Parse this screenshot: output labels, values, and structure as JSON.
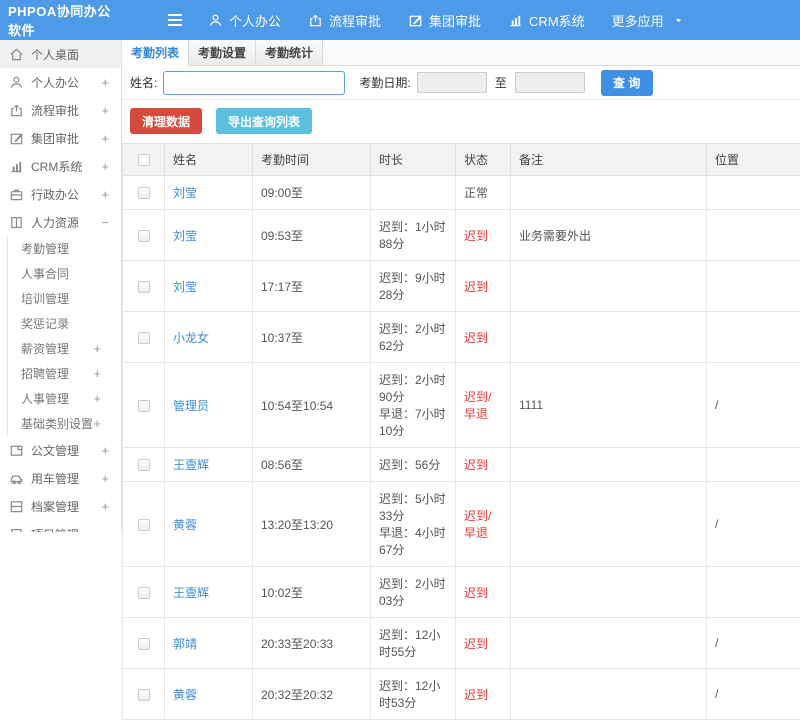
{
  "colors": {
    "header_blue": "#4d9ae8",
    "link_blue": "#3c8dde",
    "active_tab_blue": "#2f87d8",
    "query_button_blue": "#3f8fe5",
    "danger_red": "#d6493d",
    "info_blue": "#5bc0de",
    "late_text_red": "#e43a3a"
  },
  "header": {
    "logo": "PHPOA协同办公软件",
    "menu_icon": "menu-icon",
    "nav": [
      {
        "label": "个人办公",
        "icon": "user-icon",
        "caret": false
      },
      {
        "label": "流程审批",
        "icon": "share-icon",
        "caret": false
      },
      {
        "label": "集团审批",
        "icon": "edit-icon",
        "caret": false
      },
      {
        "label": "CRM系统",
        "icon": "chart-icon",
        "caret": false
      },
      {
        "label": "更多应用",
        "icon": "",
        "caret": true,
        "caret_icon": "caret-down-icon"
      }
    ]
  },
  "sidebar": {
    "items": [
      {
        "label": "个人桌面",
        "icon": "home-icon",
        "level": 0,
        "active": true,
        "expand": ""
      },
      {
        "label": "个人办公",
        "icon": "user-icon",
        "level": 0,
        "active": false,
        "expand": "+"
      },
      {
        "label": "流程审批",
        "icon": "share-icon",
        "level": 0,
        "active": false,
        "expand": "+"
      },
      {
        "label": "集团审批",
        "icon": "edit-icon",
        "level": 0,
        "active": false,
        "expand": "+"
      },
      {
        "label": "CRM系统",
        "icon": "chart-icon",
        "level": 0,
        "active": false,
        "expand": "+"
      },
      {
        "label": "行政办公",
        "icon": "briefcase-icon",
        "level": 0,
        "active": false,
        "expand": "+"
      },
      {
        "label": "人力资源",
        "icon": "book-icon",
        "level": 0,
        "active": false,
        "expand": "−"
      },
      {
        "label": "考勤管理",
        "icon": "",
        "level": 1,
        "active": false,
        "expand": ""
      },
      {
        "label": "人事合同",
        "icon": "",
        "level": 1,
        "active": false,
        "expand": ""
      },
      {
        "label": "培训管理",
        "icon": "",
        "level": 1,
        "active": false,
        "expand": ""
      },
      {
        "label": "奖惩记录",
        "icon": "",
        "level": 1,
        "active": false,
        "expand": ""
      },
      {
        "label": "薪资管理",
        "icon": "",
        "level": 1,
        "active": false,
        "expand": "+"
      },
      {
        "label": "招聘管理",
        "icon": "",
        "level": 1,
        "active": false,
        "expand": "+"
      },
      {
        "label": "人事管理",
        "icon": "",
        "level": 1,
        "active": false,
        "expand": "+"
      },
      {
        "label": "基础类别设置",
        "icon": "",
        "level": 1,
        "active": false,
        "expand": "+"
      },
      {
        "label": "公文管理",
        "icon": "document-icon",
        "level": 0,
        "active": false,
        "expand": "+"
      },
      {
        "label": "用车管理",
        "icon": "car-icon",
        "level": 0,
        "active": false,
        "expand": "+"
      },
      {
        "label": "档案管理",
        "icon": "archive-icon",
        "level": 0,
        "active": false,
        "expand": "+"
      },
      {
        "label": "项目管理",
        "icon": "project-icon",
        "level": 0,
        "active": false,
        "expand": "+"
      }
    ]
  },
  "tabs": [
    {
      "label": "考勤列表",
      "active": true
    },
    {
      "label": "考勤设置",
      "active": false
    },
    {
      "label": "考勤统计",
      "active": false
    }
  ],
  "search": {
    "name_label": "姓名:",
    "name_value": "",
    "date_label": "考勤日期:",
    "date_from": "",
    "to_label": "至",
    "date_to": "",
    "query_button": "查 询"
  },
  "actions": {
    "clean_data": "清理数据",
    "export_list": "导出查询列表"
  },
  "table": {
    "columns": [
      "姓名",
      "考勤时间",
      "时长",
      "状态",
      "备注",
      "位置"
    ],
    "rows": [
      {
        "name": "刘莹",
        "time": "09:00至",
        "duration": "",
        "status": "正常",
        "is_late": false,
        "remark": "",
        "location": ""
      },
      {
        "name": "刘莹",
        "time": "09:53至",
        "duration": "迟到：1小时88分",
        "status": "迟到",
        "is_late": true,
        "remark": "业务需要外出",
        "location": ""
      },
      {
        "name": "刘莹",
        "time": "17:17至",
        "duration": "迟到：9小时28分",
        "status": "迟到",
        "is_late": true,
        "remark": "",
        "location": ""
      },
      {
        "name": "小龙女",
        "time": "10:37至",
        "duration": "迟到：2小时62分",
        "status": "迟到",
        "is_late": true,
        "remark": "",
        "location": ""
      },
      {
        "name": "管理员",
        "time": "10:54至10:54",
        "duration": [
          "迟到：2小时90分",
          "早退：7小时10分"
        ],
        "status": "迟到/早退",
        "is_late": true,
        "remark": "1111",
        "location": "/"
      },
      {
        "name": "王壹辉",
        "time": "08:56至",
        "duration": "迟到：56分",
        "status": "迟到",
        "is_late": true,
        "remark": "",
        "location": ""
      },
      {
        "name": "黄蓉",
        "time": "13:20至13:20",
        "duration": [
          "迟到：5小时33分",
          "早退：4小时67分"
        ],
        "status": "迟到/早退",
        "is_late": true,
        "remark": "",
        "location": "/"
      },
      {
        "name": "王壹辉",
        "time": "10:02至",
        "duration": "迟到：2小时03分",
        "status": "迟到",
        "is_late": true,
        "remark": "",
        "location": ""
      },
      {
        "name": "郭靖",
        "time": "20:33至20:33",
        "duration": "迟到：12小时55分",
        "status": "迟到",
        "is_late": true,
        "remark": "",
        "location": "/"
      },
      {
        "name": "黄蓉",
        "time": "20:32至20:32",
        "duration": "迟到：12小时53分",
        "status": "迟到",
        "is_late": true,
        "remark": "",
        "location": "/"
      }
    ]
  }
}
